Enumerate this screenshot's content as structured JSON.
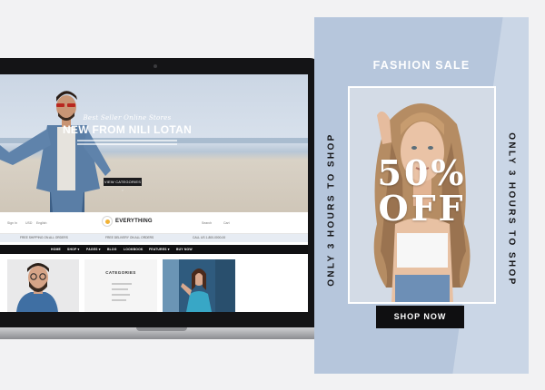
{
  "website": {
    "hero": {
      "subtitle": "Best Seller Online Stores",
      "title": "NEW FROM NILI LOTAN",
      "button": "VIEW CATEGORIES  ›"
    },
    "header": {
      "left_links": [
        "Sign In",
        "USD",
        "English"
      ],
      "logo": "EVERYTHING",
      "right_links": [
        "Search",
        "Cart"
      ]
    },
    "promo_bar": [
      "FREE SHIPPING ON ALL ORDERS",
      "FREE DELIVERY ON ALL ORDERS",
      "CALL US 1-800-0000-00"
    ],
    "nav": [
      "HOME",
      "SHOP ▾",
      "PAGES ▾",
      "BLOG",
      "LOOKBOOK",
      "FEATURES ▾",
      "BUY NOW"
    ],
    "categories_title": "CATEGORIES"
  },
  "ad": {
    "heading": "FASHION SALE",
    "offer": "50% OFF",
    "side_text": "ONLY 3 HOURS TO SHOP",
    "button": "SHOP NOW",
    "colors": {
      "background": "#b6c6dc",
      "button": "#0f0f11",
      "text": "#ffffff"
    }
  }
}
